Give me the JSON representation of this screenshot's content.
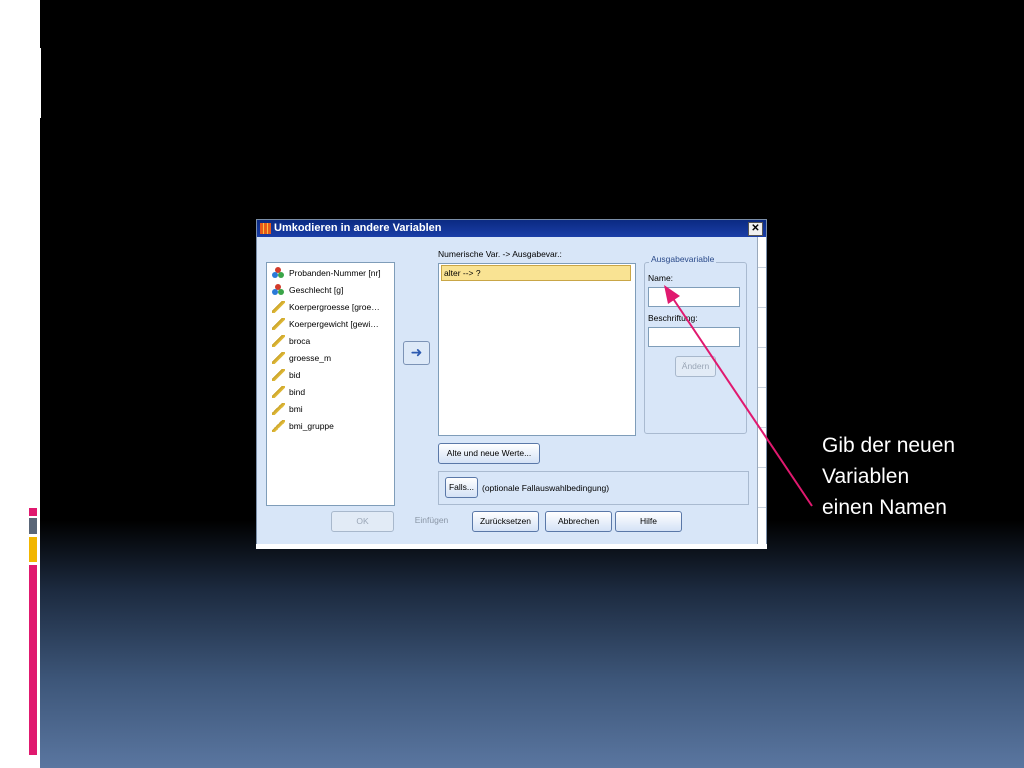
{
  "dialog": {
    "title": "Umkodieren in andere Variablen",
    "close_glyph": "✕",
    "variables": [
      {
        "label": "Probanden-Nummer [nr]",
        "icon": "nominal-icon"
      },
      {
        "label": "Geschlecht [g]",
        "icon": "nominal-icon"
      },
      {
        "label": "Koerpergroesse [groe…",
        "icon": "scale-icon"
      },
      {
        "label": "Koerpergewicht [gewi…",
        "icon": "scale-icon"
      },
      {
        "label": "broca",
        "icon": "scale-icon"
      },
      {
        "label": "groesse_m",
        "icon": "scale-icon"
      },
      {
        "label": "bid",
        "icon": "scale-icon"
      },
      {
        "label": "bind",
        "icon": "scale-icon"
      },
      {
        "label": "bmi",
        "icon": "scale-icon"
      },
      {
        "label": "bmi_gruppe",
        "icon": "scale-icon"
      }
    ],
    "move_glyph": "➜",
    "mapping_label": "Numerische Var. -> Ausgabevar.:",
    "mappings": [
      "alter --> ?"
    ],
    "output_group": {
      "legend": "Ausgabevariable",
      "name_label": "Name:",
      "name_value": "",
      "description_label": "Beschriftung:",
      "description_value": "",
      "change_button": "Ändern"
    },
    "old_new_values_button": "Alte und neue Werte...",
    "if_button": "Falls...",
    "if_hint": "(optionale Fallauswahlbedingung)",
    "buttons": {
      "ok": "OK",
      "paste": "Einfügen",
      "reset": "Zurücksetzen",
      "cancel": "Abbrechen",
      "help": "Hilfe"
    }
  },
  "annotation": {
    "lines": [
      "Gib der neuen",
      "Variablen",
      "einen Namen"
    ],
    "color": "#e0196f"
  },
  "colors": {
    "accent_pink": "#e0196f",
    "accent_gray": "#5a6678",
    "accent_yellow": "#f2b600",
    "dialog_bg": "#d8e6f8",
    "mapping_highlight": "#f9e393"
  }
}
